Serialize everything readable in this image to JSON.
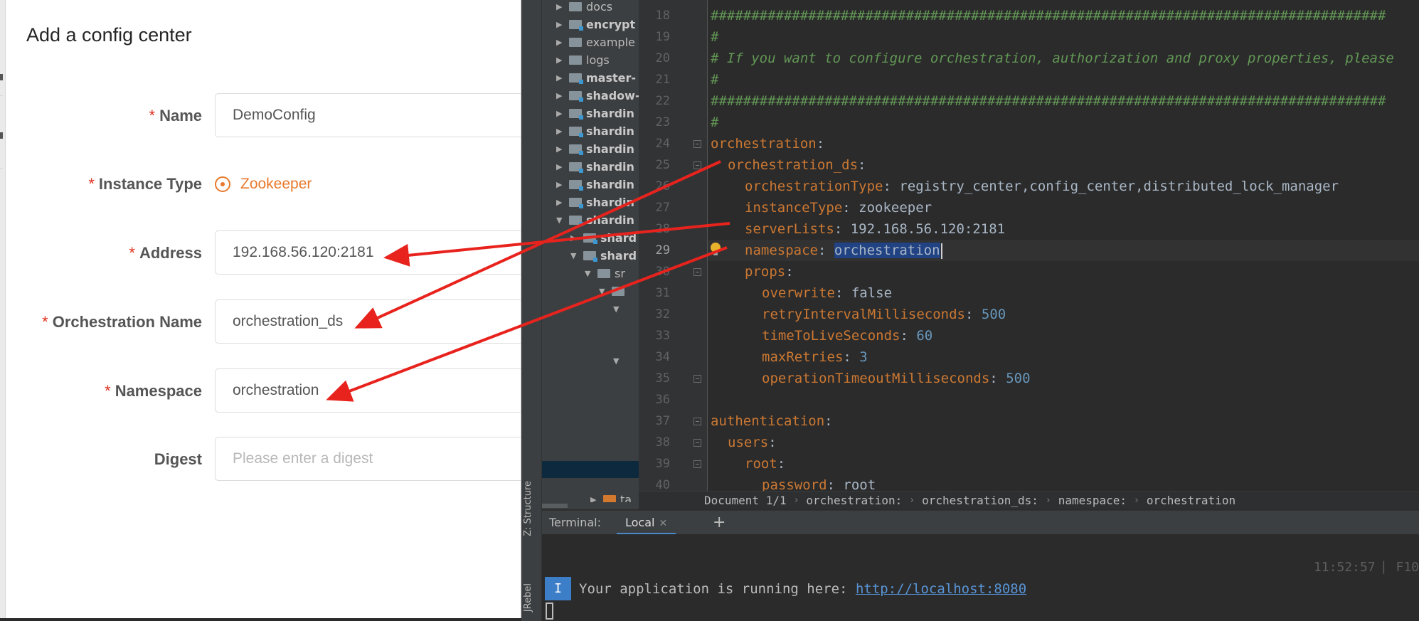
{
  "dialog": {
    "title": "Add a config center",
    "fields": {
      "name": {
        "label": "Name",
        "required": "*",
        "value": "DemoConfig"
      },
      "instance_type": {
        "label": "Instance Type",
        "required": "*",
        "selected": "Zookeeper"
      },
      "address": {
        "label": "Address",
        "required": "*",
        "value": "192.168.56.120:2181"
      },
      "orchestration_name": {
        "label": "Orchestration Name",
        "required": "*",
        "value": "orchestration_ds"
      },
      "namespace": {
        "label": "Namespace",
        "required": "*",
        "value": "orchestration"
      },
      "digest": {
        "label": "Digest",
        "placeholder": "Please enter a digest"
      }
    }
  },
  "ide": {
    "side_tabs": {
      "structure": "Z: Structure",
      "jrebel": "JRebel"
    },
    "tree": [
      {
        "label": "docs"
      },
      {
        "label": "encrypt"
      },
      {
        "label": "example"
      },
      {
        "label": "logs"
      },
      {
        "label": "master-"
      },
      {
        "label": "shadow-"
      },
      {
        "label": "shardin"
      },
      {
        "label": "shardin"
      },
      {
        "label": "shardin"
      },
      {
        "label": "shardin"
      },
      {
        "label": "shardin"
      },
      {
        "label": "shardin"
      },
      {
        "label": "shardin"
      },
      {
        "label": "shard"
      },
      {
        "label": "shard"
      },
      {
        "label": "sr"
      },
      {
        "label": "ta"
      }
    ],
    "line_numbers": [
      "18",
      "19",
      "20",
      "21",
      "22",
      "23",
      "24",
      "25",
      "26",
      "27",
      "28",
      "29",
      "30",
      "31",
      "32",
      "33",
      "34",
      "35",
      "36",
      "37",
      "38",
      "39",
      "40"
    ],
    "code": {
      "l18": "###################################################################################",
      "l19": "#",
      "l20": "# If you want to configure orchestration, authorization and proxy properties, please",
      "l21": "#",
      "l22": "###################################################################################",
      "l23": "#",
      "k_orchestration": "orchestration",
      "k_orchestration_ds": "orchestration_ds",
      "k_type": "orchestrationType",
      "v_type": "registry_center,config_center,distributed_lock_manager",
      "k_instance": "instanceType",
      "v_instance": "zookeeper",
      "k_servers": "serverLists",
      "v_servers": "192.168.56.120:2181",
      "k_namespace": "namespace",
      "v_namespace": "orchestration",
      "k_props": "props",
      "k_overwrite": "overwrite",
      "v_overwrite": "false",
      "k_retry": "retryIntervalMilliseconds",
      "v_retry": "500",
      "k_ttl": "timeToLiveSeconds",
      "v_ttl": "60",
      "k_maxretries": "maxRetries",
      "v_maxretries": "3",
      "k_optimeout": "operationTimeoutMilliseconds",
      "v_optimeout": "500",
      "k_authentication": "authentication",
      "k_users": "users",
      "k_root": "root",
      "k_password": "password",
      "v_password": "root"
    },
    "breadcrumb": [
      "Document 1/1",
      "orchestration:",
      "orchestration_ds:",
      "namespace:",
      "orchestration"
    ],
    "terminal": {
      "title": "Terminal:",
      "tab": "Local",
      "add": "+",
      "time": "11:52:57",
      "time_suffix": "F10",
      "badge": "I",
      "message": "Your application is running here: ",
      "link": "http://localhost:8080"
    }
  }
}
